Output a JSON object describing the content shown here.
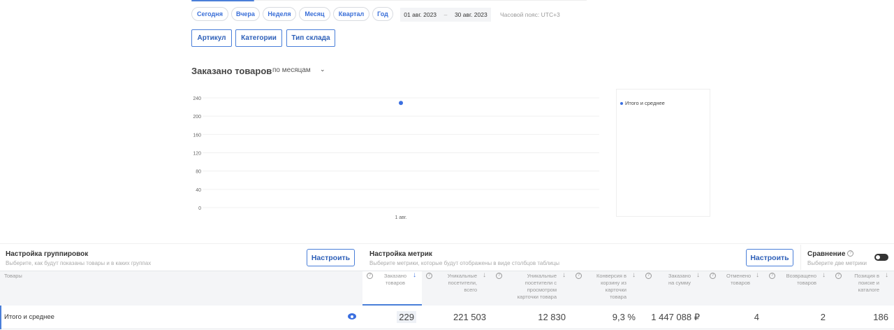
{
  "periods": [
    "Сегодня",
    "Вчера",
    "Неделя",
    "Месяц",
    "Квартал",
    "Год"
  ],
  "date_from": "01 авг. 2023",
  "date_sep": "–",
  "date_to": "30 авг. 2023",
  "timezone": "Часовой пояс: UTC+3",
  "group_buttons": [
    "Артикул",
    "Категории",
    "Тип склада"
  ],
  "chart_title": "Заказано товаров",
  "chart_period": "по месяцам",
  "chart_data": {
    "type": "scatter",
    "x": [
      "1 авг."
    ],
    "series": [
      {
        "name": "Итого и среднее",
        "values": [
          229
        ],
        "color": "#3b6fe0"
      }
    ],
    "yticks": [
      0,
      40,
      80,
      120,
      160,
      200,
      240
    ],
    "ylim": [
      0,
      240
    ],
    "grid": true,
    "legend": "right"
  },
  "grouping": {
    "title": "Настройка группировок",
    "subtitle": "Выберите, как будут показаны товары и в каких группах",
    "button": "Настроить"
  },
  "metrics": {
    "title": "Настройка метрик",
    "subtitle": "Выберите метрики, которые будут отображены в виде столбцов таблицы",
    "button": "Настроить"
  },
  "compare": {
    "title": "Сравнение",
    "subtitle": "Выберите две метрики",
    "enabled": false
  },
  "table": {
    "first_header": "Товары",
    "headers": [
      "Заказано товаров",
      "Уникальные посетители, всего",
      "Уникальные посетители с просмотром карточки товара",
      "Конверсия в корзину из карточки товара",
      "Заказано на сумму",
      "Отменено товаров",
      "Возвращено товаров",
      "Позиция в поиске и каталоге"
    ],
    "row_label": "Итого и среднее",
    "values": [
      "229",
      "221 503",
      "12 830",
      "9,3 %",
      "1 447 088 ₽",
      "4",
      "2",
      "186"
    ]
  }
}
